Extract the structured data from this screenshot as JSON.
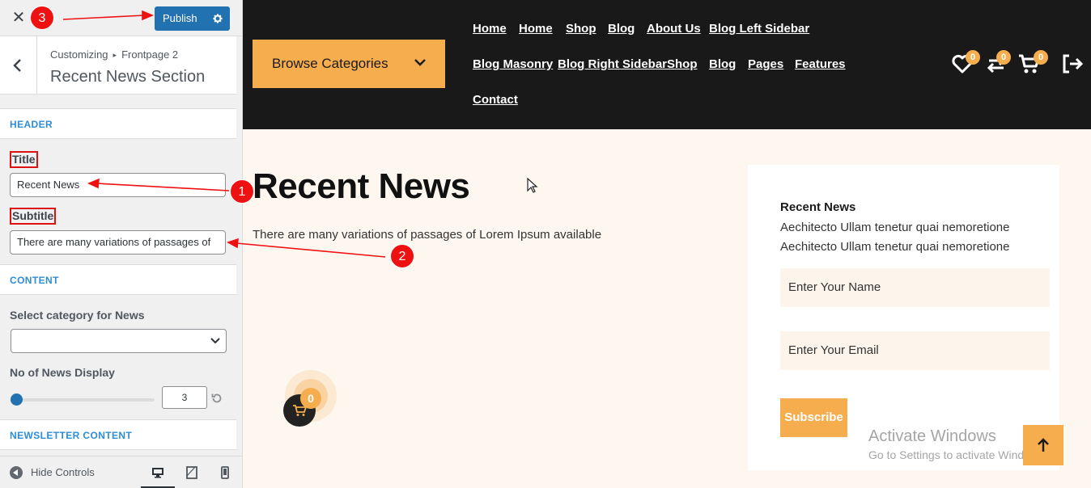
{
  "customizer": {
    "publish_label": "Publish",
    "breadcrumb_root": "Customizing",
    "breadcrumb_separator": "▸",
    "breadcrumb_parent": "Frontpage 2",
    "section_title": "Recent News Section",
    "header_section": "HEADER",
    "title_label": "Title",
    "title_value": "Recent News",
    "subtitle_label": "Subtitle",
    "subtitle_value": "There are many variations of passages of",
    "content_section": "CONTENT",
    "category_label": "Select category for News",
    "category_value": "",
    "news_count_label": "No of News Display",
    "news_count_value": "3",
    "newsletter_section": "NEWSLETTER CONTENT",
    "hide_controls": "Hide Controls"
  },
  "site": {
    "browse_categories": "Browse Categories",
    "nav_row1": [
      "Home",
      "Home",
      "Shop",
      "Blog",
      "About Us",
      "Blog Left Sidebar"
    ],
    "nav_row2": [
      "Blog Masonry",
      "Blog Right Sidebar",
      "Shop",
      "Blog",
      "Pages",
      "Features"
    ],
    "nav_row3": [
      "Contact"
    ],
    "wishlist_count": "0",
    "compare_count": "0",
    "cart_count": "0",
    "news_title": "Recent News",
    "news_subtitle": "There are many variations of passages of Lorem Ipsum available",
    "newsletter_title": "Recent News",
    "newsletter_text": "Aechitecto Ullam tenetur quai nemoretione Aechitecto Ullam tenetur quai nemoretione",
    "name_placeholder": "Enter Your Name",
    "email_placeholder": "Enter Your Email",
    "subscribe_label": "Subscribe",
    "floating_cart_count": "0"
  },
  "watermark": {
    "line1": "Activate Windows",
    "line2": "Go to Settings to activate Windows."
  },
  "annotations": [
    "1",
    "2",
    "3"
  ],
  "colors": {
    "accent": "#f5ad4d",
    "header_bg": "#1a1919",
    "wp_blue": "#2271b1",
    "annotation_red": "#e11"
  }
}
